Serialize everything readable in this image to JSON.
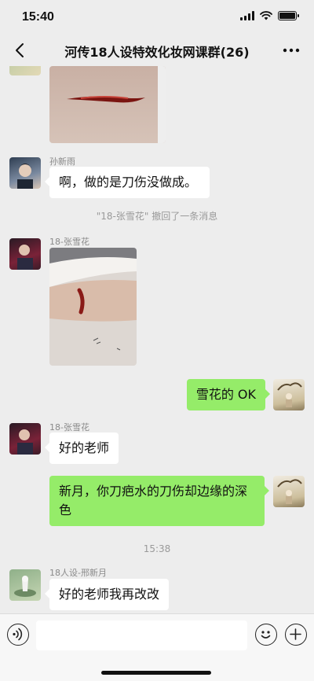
{
  "status_bar": {
    "time": "15:40"
  },
  "nav": {
    "title": "河传18人设特效化妆网课群(26)"
  },
  "messages": [
    {
      "sender": "孙新雨",
      "text": "啊，做的是刀伤没做成。"
    },
    {
      "system": "\"18-张雪花\" 撤回了一条消息"
    },
    {
      "sender": "18-张雪花"
    },
    {
      "text": "雪花的 OK"
    },
    {
      "sender": "18-张雪花",
      "text": "好的老师"
    },
    {
      "text": "新月，你刀疤水的刀伤却边缘的深色"
    },
    {
      "time": "15:38"
    },
    {
      "sender": "18人设-邢新月",
      "text": "好的老师我再改改"
    }
  ],
  "icons": {
    "back": "chevron-left-icon",
    "more": "more-dots-icon",
    "voice": "voice-icon",
    "emoji": "emoji-icon",
    "add": "plus-icon"
  },
  "colors": {
    "background": "#ededed",
    "green_bubble": "#95ec69",
    "white_bubble": "#ffffff"
  }
}
